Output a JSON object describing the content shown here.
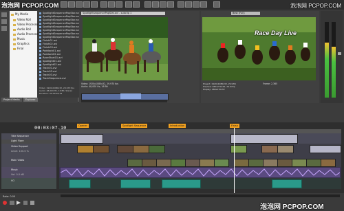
{
  "watermarks": {
    "top_left": "泡泡网 PCPOP.COM",
    "top_right": "泡泡网 PCPOP.COM",
    "bottom_right": "泡泡网 PCPOP.COM"
  },
  "preview": {
    "source_title": "SpotlightsequencePopStar.avi - subclip 1",
    "program_title": "Best (Full)",
    "overlay_title": "Race Day Live",
    "source_info": "Video: 1920x1080x32, 29.970 fps\nAudio: 48,000 Hz, 16 Bit",
    "program_info": "Project: 1920x1080x32, 29.970i\nPreview: 480x270x32, 29.970p\nDisplay: 480x270x32",
    "frame_label": "Frame:",
    "frame_value": "2,365"
  },
  "explorer": {
    "tree": [
      "My Media",
      "Video Roll",
      "Video Processed",
      "Audio Roll",
      "Audio Processed",
      "Music",
      "Graphics",
      "Final"
    ],
    "files": [
      "SpotlightSequencePopStar.avi",
      "SpotlightSequencePopStar.avi",
      "SpotlightSequencePopStar.avi",
      "SpotlightSequencePopStar.avi",
      "SpotlightSequencePopStar.avi",
      "SpotlightSequencePopStar.avi",
      "SpotlightSequencePopStar.avi",
      "SpotlightSequencePopStar.avi",
      "Finish01.avi",
      "Finish02.avi",
      "Finish03.avi",
      "Paddock01.avi",
      "Paddock02.avi",
      "RaceStart01.avi",
      "Spotlight01.avi",
      "Spotlight02.avi",
      "Track01.avi",
      "Track02.avi",
      "Track03.avi",
      "TrackSequence.avi"
    ],
    "info": "Video: 1920x1080x32, 29.970 fps\nAudio: 48,000 Hz, 16 Bit, Stereo\nDuration: 00:00:28;19"
  },
  "tabs": [
    "Project Media",
    "Explorer",
    "Transitions",
    "Video FX",
    "Media Generators"
  ],
  "timeline": {
    "timecode": "00:03:07.10",
    "markers": [
      "Opener",
      "Spotlight Sequence",
      "Introduction",
      "Finish"
    ],
    "tracks": [
      {
        "name": "Title Sequence",
        "kind": "video"
      },
      {
        "name": "Light Flare",
        "kind": "video"
      },
      {
        "name": "Video Support",
        "kind": "video"
      },
      {
        "name": "Level: 100.0 %",
        "kind": "video"
      },
      {
        "name": "Main Video",
        "kind": "video"
      },
      {
        "name": "Music",
        "kind": "audio"
      },
      {
        "name": "Vol: 0.0 dB",
        "kind": "audio"
      },
      {
        "name": "VO",
        "kind": "audio"
      }
    ],
    "ruler": [
      "00:00:00",
      "00:00:30",
      "00:01:00",
      "00:01:30",
      "00:02:00",
      "00:02:30",
      "00:03:00",
      "00:03:30",
      "00:04:00"
    ],
    "bottom_status": "Rate: 0.00"
  },
  "colors": {
    "accent": "#f0a020",
    "video_clip": "#6b6b8c",
    "audio_wave": "#9a7ad0",
    "vo_clip": "#2a9a8a"
  }
}
